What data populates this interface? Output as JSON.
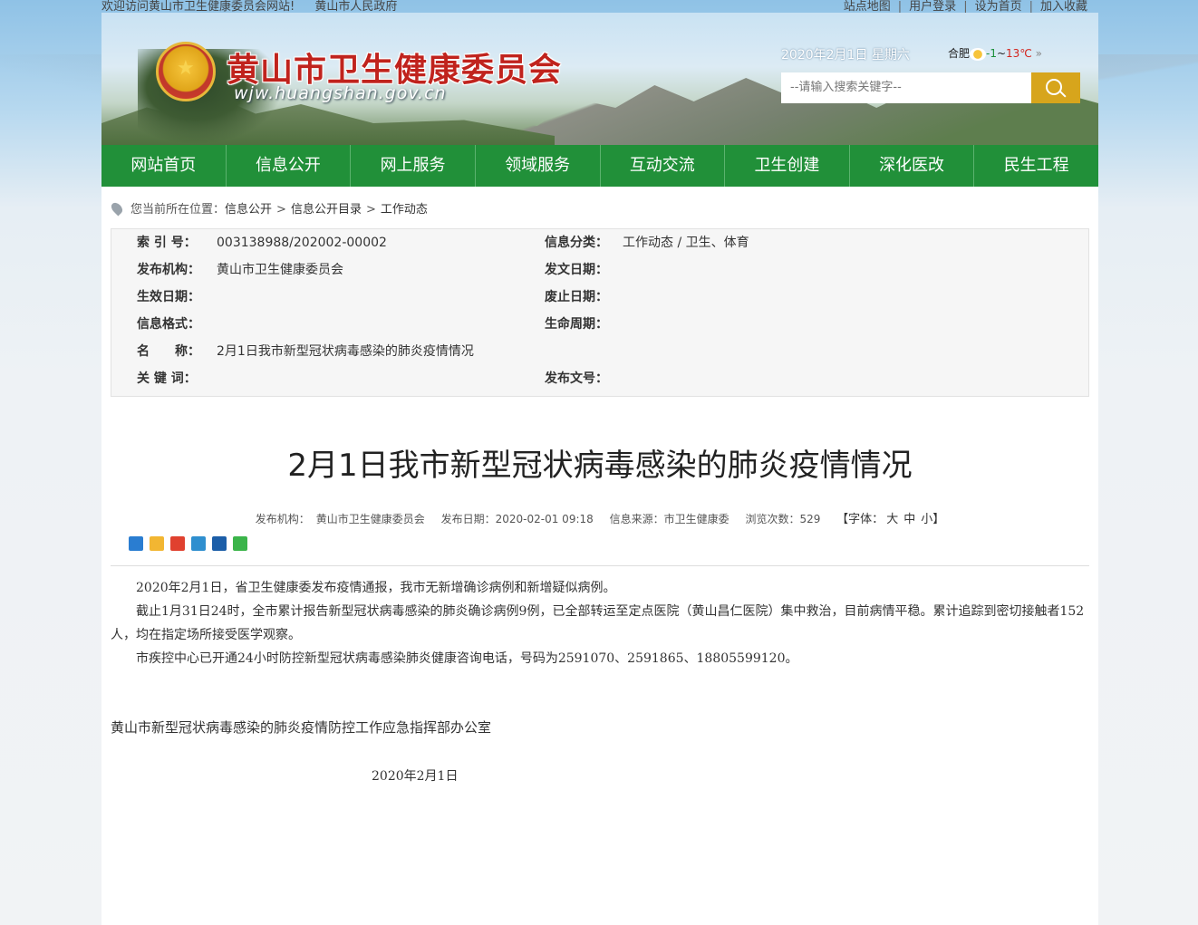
{
  "topbar": {
    "welcome": "欢迎访问黄山市卫生健康委员会网站!",
    "gov_link": "黄山市人民政府",
    "links": [
      "站点地图",
      "用户登录",
      "设为首页",
      "加入收藏"
    ]
  },
  "header": {
    "title": "黄山市卫生健康委员会",
    "domain": "wjw.huangshan.gov.cn",
    "date": "2020年2月1日 星期六",
    "weather_city": "合肥",
    "weather_low": "-1",
    "weather_sep": "~",
    "weather_high": "13℃",
    "weather_more": "»",
    "search_placeholder": "--请输入搜索关键字--"
  },
  "nav": [
    "网站首页",
    "信息公开",
    "网上服务",
    "领域服务",
    "互动交流",
    "卫生创建",
    "深化医改",
    "民生工程"
  ],
  "breadcrumb": {
    "prefix": "您当前所在位置：",
    "items": [
      "信息公开",
      "信息公开目录",
      "工作动态"
    ],
    "sep": ">"
  },
  "info": {
    "index_label": "索 引 号：",
    "index_value": "003138988/202002-00002",
    "category_label": "信息分类：",
    "category_value": "工作动态 / 卫生、体育",
    "publisher_label": "发布机构：",
    "publisher_value": "黄山市卫生健康委员会",
    "issue_date_label": "发文日期：",
    "effective_label": "生效日期：",
    "repeal_label": "废止日期：",
    "format_label": "信息格式：",
    "lifecycle_label": "生命周期：",
    "name_label": "名　　称：",
    "name_value": "2月1日我市新型冠状病毒感染的肺炎疫情情况",
    "keywords_label": "关 键 词：",
    "doc_no_label": "发布文号："
  },
  "article": {
    "title": "2月1日我市新型冠状病毒感染的肺炎疫情情况",
    "meta_publisher_label": "发布机构：",
    "meta_publisher": "黄山市卫生健康委员会",
    "meta_date": "发布日期：2020-02-01 09:18",
    "meta_source": "信息来源：市卫生健康委",
    "meta_views": "浏览次数：529",
    "meta_font_prefix": "【字体：",
    "meta_font_large": "大",
    "meta_font_medium": "中",
    "meta_font_small": "小】",
    "paragraphs": [
      "2020年2月1日，省卫生健康委发布疫情通报，我市无新增确诊病例和新增疑似病例。",
      "截止1月31日24时，全市累计报告新型冠状病毒感染的肺炎确诊病例9例，已全部转运至定点医院（黄山昌仁医院）集中救治，目前病情平稳。累计追踪到密切接触者152人，均在指定场所接受医学观察。",
      "市疾控中心已开通24小时防控新型冠状病毒感染肺炎健康咨询电话，号码为2591070、2591865、18805599120。"
    ],
    "signoff": "黄山市新型冠状病毒感染的肺炎疫情防控工作应急指挥部办公室",
    "signdate": "2020年2月1日"
  },
  "colors": {
    "nav_green": "#219039",
    "title_red": "#c0231d",
    "search_button": "#d7a51c"
  }
}
